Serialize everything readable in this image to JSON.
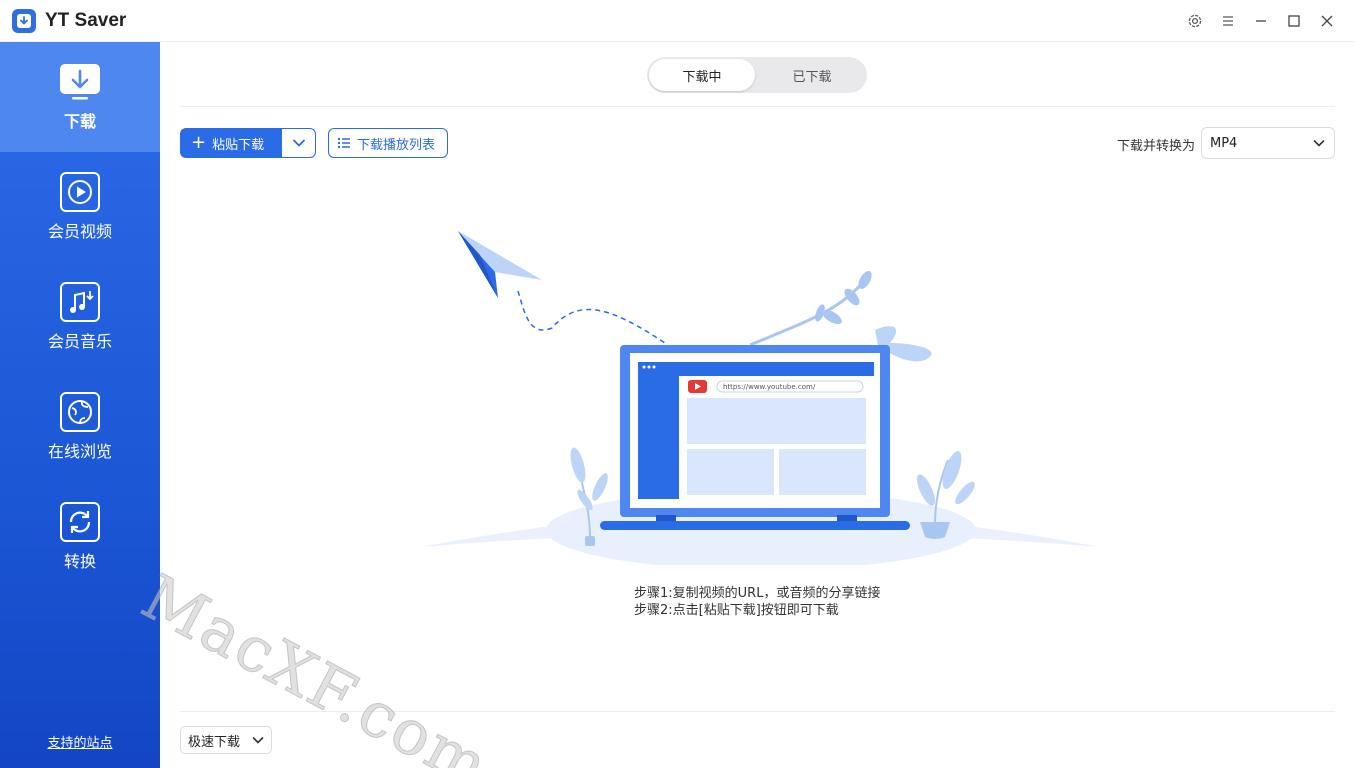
{
  "app": {
    "title": "YT Saver"
  },
  "sidebar": {
    "items": [
      {
        "label": "下载",
        "icon": "download-icon",
        "active": true
      },
      {
        "label": "会员视频",
        "icon": "play-icon",
        "active": false
      },
      {
        "label": "会员音乐",
        "icon": "music-icon",
        "active": false
      },
      {
        "label": "在线浏览",
        "icon": "globe-icon",
        "active": false
      },
      {
        "label": "转换",
        "icon": "convert-icon",
        "active": false
      }
    ],
    "support_link": "支持的站点"
  },
  "tabs": [
    {
      "label": "下载中",
      "active": true
    },
    {
      "label": "已下载",
      "active": false
    }
  ],
  "toolbar": {
    "paste_download": "粘贴下载",
    "download_playlist": "下载播放列表",
    "convert_label": "下载并转换为",
    "format_value": "MP4"
  },
  "illustration": {
    "url": "https://www.youtube.com/"
  },
  "steps": {
    "step1": "步骤1:复制视频的URL，或音频的分享链接",
    "step2": "步骤2:点击[粘贴下载]按钮即可下载"
  },
  "footer": {
    "speed_mode": "极速下载"
  },
  "watermark": "MacXF.com",
  "colors": {
    "accent": "#2a6be6",
    "sidebar": "#1c58d6",
    "sidebar_active": "#4f87f0"
  }
}
